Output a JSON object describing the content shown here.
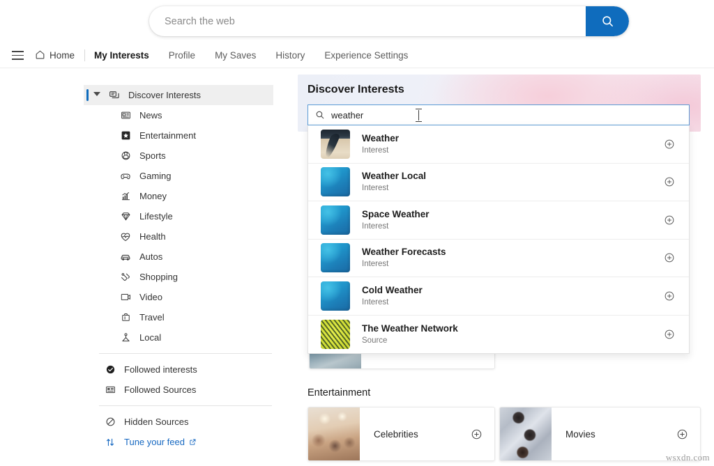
{
  "websearch": {
    "placeholder": "Search the web",
    "value": "",
    "button_icon": "search-icon"
  },
  "nav": {
    "menu_icon": "hamburger-icon",
    "home": {
      "label": "Home",
      "icon": "home-icon"
    },
    "items": [
      {
        "label": "My Interests",
        "active": true
      },
      {
        "label": "Profile",
        "active": false
      },
      {
        "label": "My Saves",
        "active": false
      },
      {
        "label": "History",
        "active": false
      },
      {
        "label": "Experience Settings",
        "active": false
      }
    ]
  },
  "sidebar": {
    "header": {
      "label": "Discover Interests",
      "icon": "discover-icon",
      "selected": true
    },
    "categories": [
      {
        "label": "News",
        "icon": "newspaper-icon"
      },
      {
        "label": "Entertainment",
        "icon": "star-icon"
      },
      {
        "label": "Sports",
        "icon": "ball-icon"
      },
      {
        "label": "Gaming",
        "icon": "gamepad-icon"
      },
      {
        "label": "Money",
        "icon": "chart-icon"
      },
      {
        "label": "Lifestyle",
        "icon": "gem-icon"
      },
      {
        "label": "Health",
        "icon": "heart-pulse-icon"
      },
      {
        "label": "Autos",
        "icon": "car-icon"
      },
      {
        "label": "Shopping",
        "icon": "tag-icon"
      },
      {
        "label": "Video",
        "icon": "video-icon"
      },
      {
        "label": "Travel",
        "icon": "suitcase-icon"
      },
      {
        "label": "Local",
        "icon": "location-pin-icon"
      }
    ],
    "followed": [
      {
        "label": "Followed interests",
        "icon": "check-circle-icon"
      },
      {
        "label": "Followed Sources",
        "icon": "sources-icon"
      }
    ],
    "footer": [
      {
        "label": "Hidden Sources",
        "icon": "block-icon",
        "link": false
      },
      {
        "label": "Tune your feed",
        "icon": "sort-arrows-icon",
        "link": true,
        "external_icon": "external-link-icon"
      }
    ]
  },
  "discover": {
    "title": "Discover Interests",
    "search": {
      "value": "weather",
      "placeholder": "",
      "icon": "search-icon"
    },
    "results": [
      {
        "name": "Weather",
        "type": "Interest",
        "thumb": "tornado-image",
        "add_icon": "plus-circle-icon"
      },
      {
        "name": "Weather Local",
        "type": "Interest",
        "thumb": "blue-tile",
        "add_icon": "plus-circle-icon"
      },
      {
        "name": "Space Weather",
        "type": "Interest",
        "thumb": "blue-tile",
        "add_icon": "plus-circle-icon"
      },
      {
        "name": "Weather Forecasts",
        "type": "Interest",
        "thumb": "blue-tile",
        "add_icon": "plus-circle-icon"
      },
      {
        "name": "Cold Weather",
        "type": "Interest",
        "thumb": "blue-tile",
        "add_icon": "plus-circle-icon"
      },
      {
        "name": "The Weather Network",
        "type": "Source",
        "thumb": "network-logo",
        "add_icon": "plus-circle-icon"
      }
    ]
  },
  "main": {
    "sections": [
      {
        "heading": "Entertainment",
        "cards": [
          {
            "title": "Celebrities",
            "thumb": "celebrities-image",
            "add_icon": "plus-circle-icon"
          },
          {
            "title": "Movies",
            "thumb": "movies-image",
            "add_icon": "plus-circle-icon"
          }
        ]
      }
    ]
  },
  "watermark": "wsxdn.com",
  "colors": {
    "accent_blue": "#0f6cbd",
    "link_blue": "#1668c1",
    "focus_border": "#5b9bd5",
    "selected_bg": "#efefef"
  }
}
